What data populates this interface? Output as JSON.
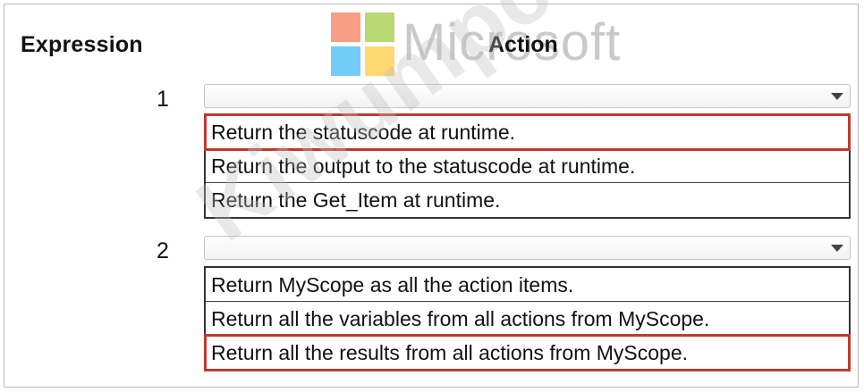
{
  "headers": {
    "expression": "Expression",
    "action": "Action"
  },
  "watermark": {
    "brand_text": "Microsoft",
    "diagonal_text": "Kiwumpcom",
    "logo_colors": [
      "#f25022",
      "#7fba00",
      "#00a4ef",
      "#ffb900"
    ]
  },
  "highlight_color": "#c0392b",
  "rows": [
    {
      "number": "1",
      "selected_value": "",
      "options": [
        {
          "label": "Return the statuscode at runtime.",
          "selected": true
        },
        {
          "label": "Return the output to the statuscode at runtime.",
          "selected": false
        },
        {
          "label": "Return the Get_Item at runtime.",
          "selected": false
        }
      ]
    },
    {
      "number": "2",
      "selected_value": "",
      "options": [
        {
          "label": "Return MyScope as all the action items.",
          "selected": false
        },
        {
          "label": "Return all the variables from all actions from MyScope.",
          "selected": false
        },
        {
          "label": "Return all the results from all actions from MyScope.",
          "selected": true
        }
      ]
    }
  ]
}
